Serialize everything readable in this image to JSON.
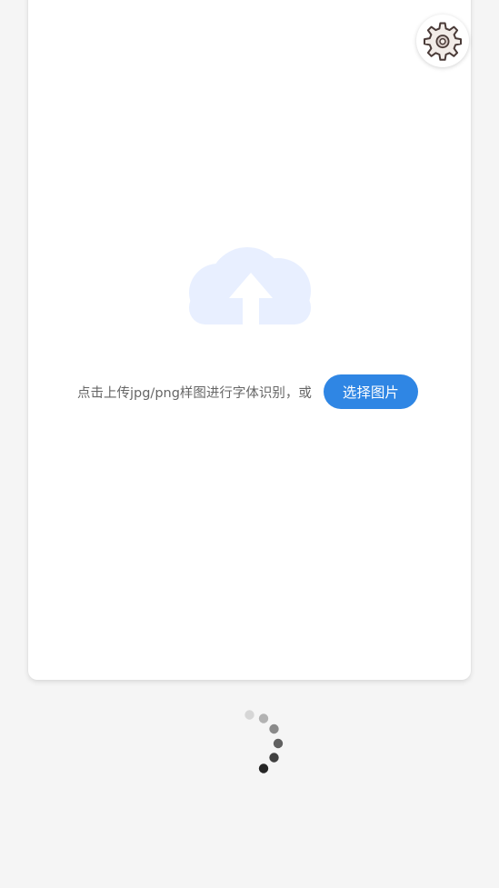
{
  "icons": {
    "settings": "gear-icon",
    "upload": "cloud-upload-icon",
    "loading": "loading-spinner-icon"
  },
  "upload": {
    "hint_text": "点击上传jpg/png样图进行字体识别，或",
    "choose_button_label": "选择图片"
  },
  "colors": {
    "background": "#f5f5f5",
    "card": "#ffffff",
    "accent": "#2f86e4",
    "cloud": "#e8efff",
    "gear_fill": "#f2ece8",
    "gear_stroke": "#4a3b38"
  }
}
